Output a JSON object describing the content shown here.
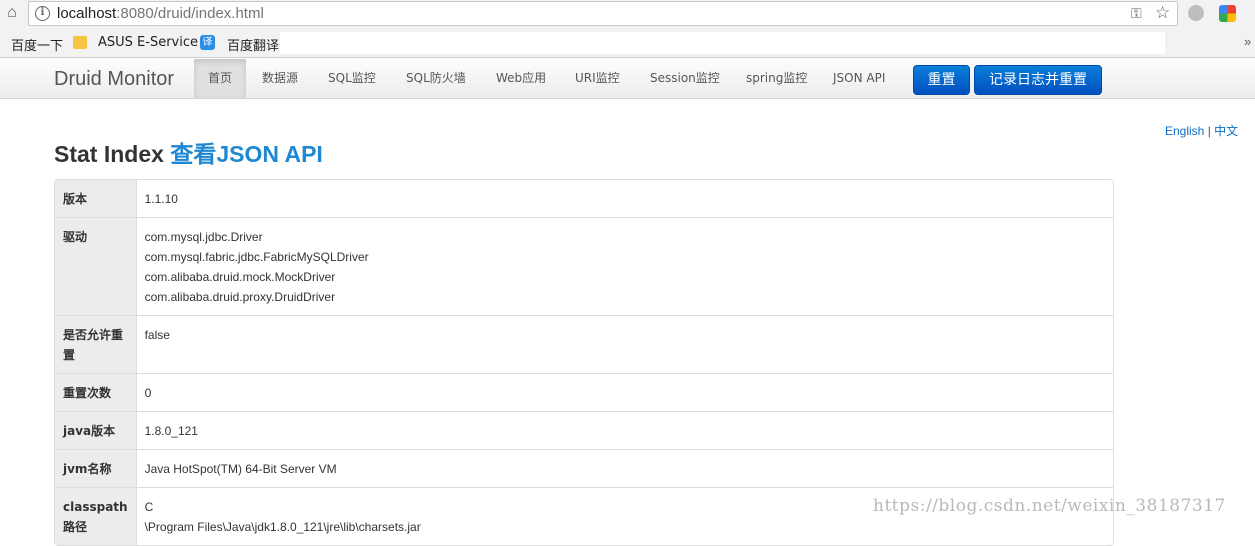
{
  "browser": {
    "url_host": "localhost",
    "url_rest": ":8080/druid/index.html",
    "bookmarks": [
      {
        "label": "百度一下"
      },
      {
        "label": "ASUS E-Service"
      },
      {
        "label": "百度翻译",
        "icon_text": "译"
      }
    ],
    "more": "»"
  },
  "nav": {
    "brand": "Druid Monitor",
    "items": [
      "首页",
      "数据源",
      "SQL监控",
      "SQL防火墙",
      "Web应用",
      "URI监控",
      "Session监控",
      "spring监控",
      "JSON API"
    ],
    "reset_button": "重置",
    "log_reset_button": "记录日志并重置"
  },
  "lang": {
    "english": "English",
    "sep": "|",
    "chinese": "中文"
  },
  "page": {
    "title": "Stat Index",
    "title_link": "查看JSON API"
  },
  "stats": [
    {
      "key": "版本",
      "values": [
        "1.1.10"
      ]
    },
    {
      "key": "驱动",
      "values": [
        "com.mysql.jdbc.Driver",
        "com.mysql.fabric.jdbc.FabricMySQLDriver",
        "com.alibaba.druid.mock.MockDriver",
        "com.alibaba.druid.proxy.DruidDriver"
      ]
    },
    {
      "key": "是否允许重置",
      "values": [
        "false"
      ]
    },
    {
      "key": "重置次数",
      "values": [
        "0"
      ]
    },
    {
      "key": "java版本",
      "values": [
        "1.8.0_121"
      ]
    },
    {
      "key": "jvm名称",
      "values": [
        "Java HotSpot(TM) 64-Bit Server VM"
      ]
    },
    {
      "key": "classpath路径",
      "values": [
        "C",
        "\\Program Files\\Java\\jdk1.8.0_121\\jre\\lib\\charsets.jar"
      ]
    }
  ],
  "watermark": "https://blog.csdn.net/weixin_38187317"
}
